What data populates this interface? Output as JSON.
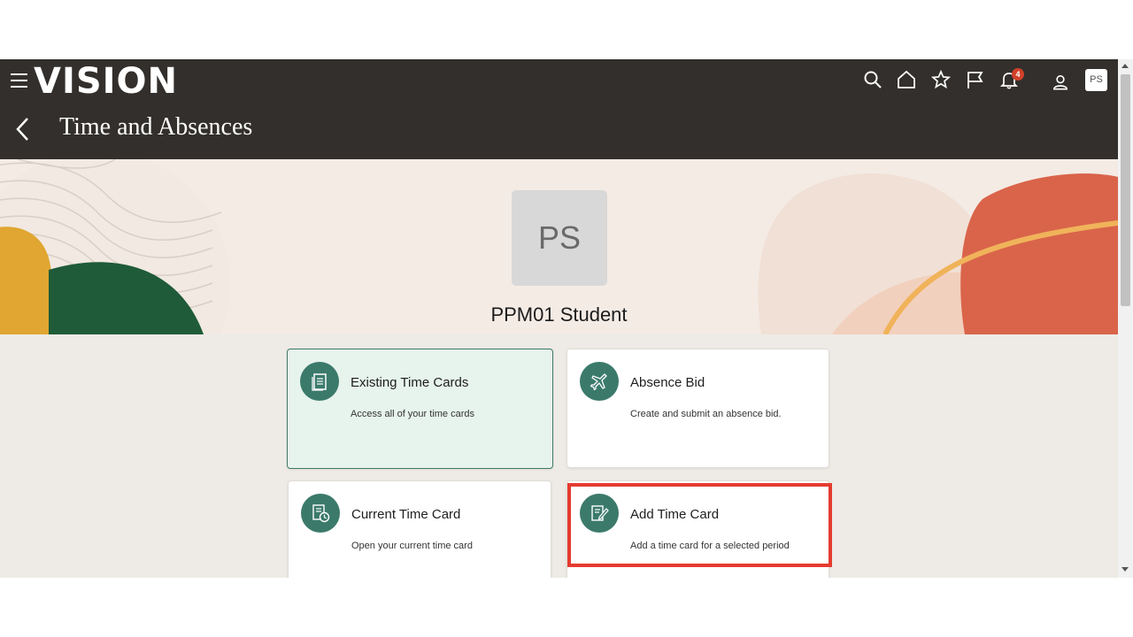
{
  "header": {
    "logo": "VISION",
    "notification_count": "4",
    "user_initials": "PS"
  },
  "page": {
    "title": "Time and Absences"
  },
  "profile": {
    "initials": "PS",
    "name": "PPM01 Student"
  },
  "cards": [
    {
      "title": "Existing Time Cards",
      "description": "Access all of your time cards",
      "icon": "document-list-icon",
      "selected": true
    },
    {
      "title": "Absence Bid",
      "description": "Create and submit an absence bid.",
      "icon": "airplane-icon",
      "selected": false
    },
    {
      "title": "Current Time Card",
      "description": "Open your current time card",
      "icon": "timecard-clock-icon",
      "selected": false
    },
    {
      "title": "Add Time Card",
      "description": "Add a time card for a selected period",
      "icon": "timecard-edit-icon",
      "selected": false,
      "highlighted": true
    }
  ],
  "colors": {
    "header_bg": "#322f2c",
    "accent_teal": "#3b7a6b",
    "highlight_red": "#e53b30",
    "badge_red": "#d1402a"
  }
}
